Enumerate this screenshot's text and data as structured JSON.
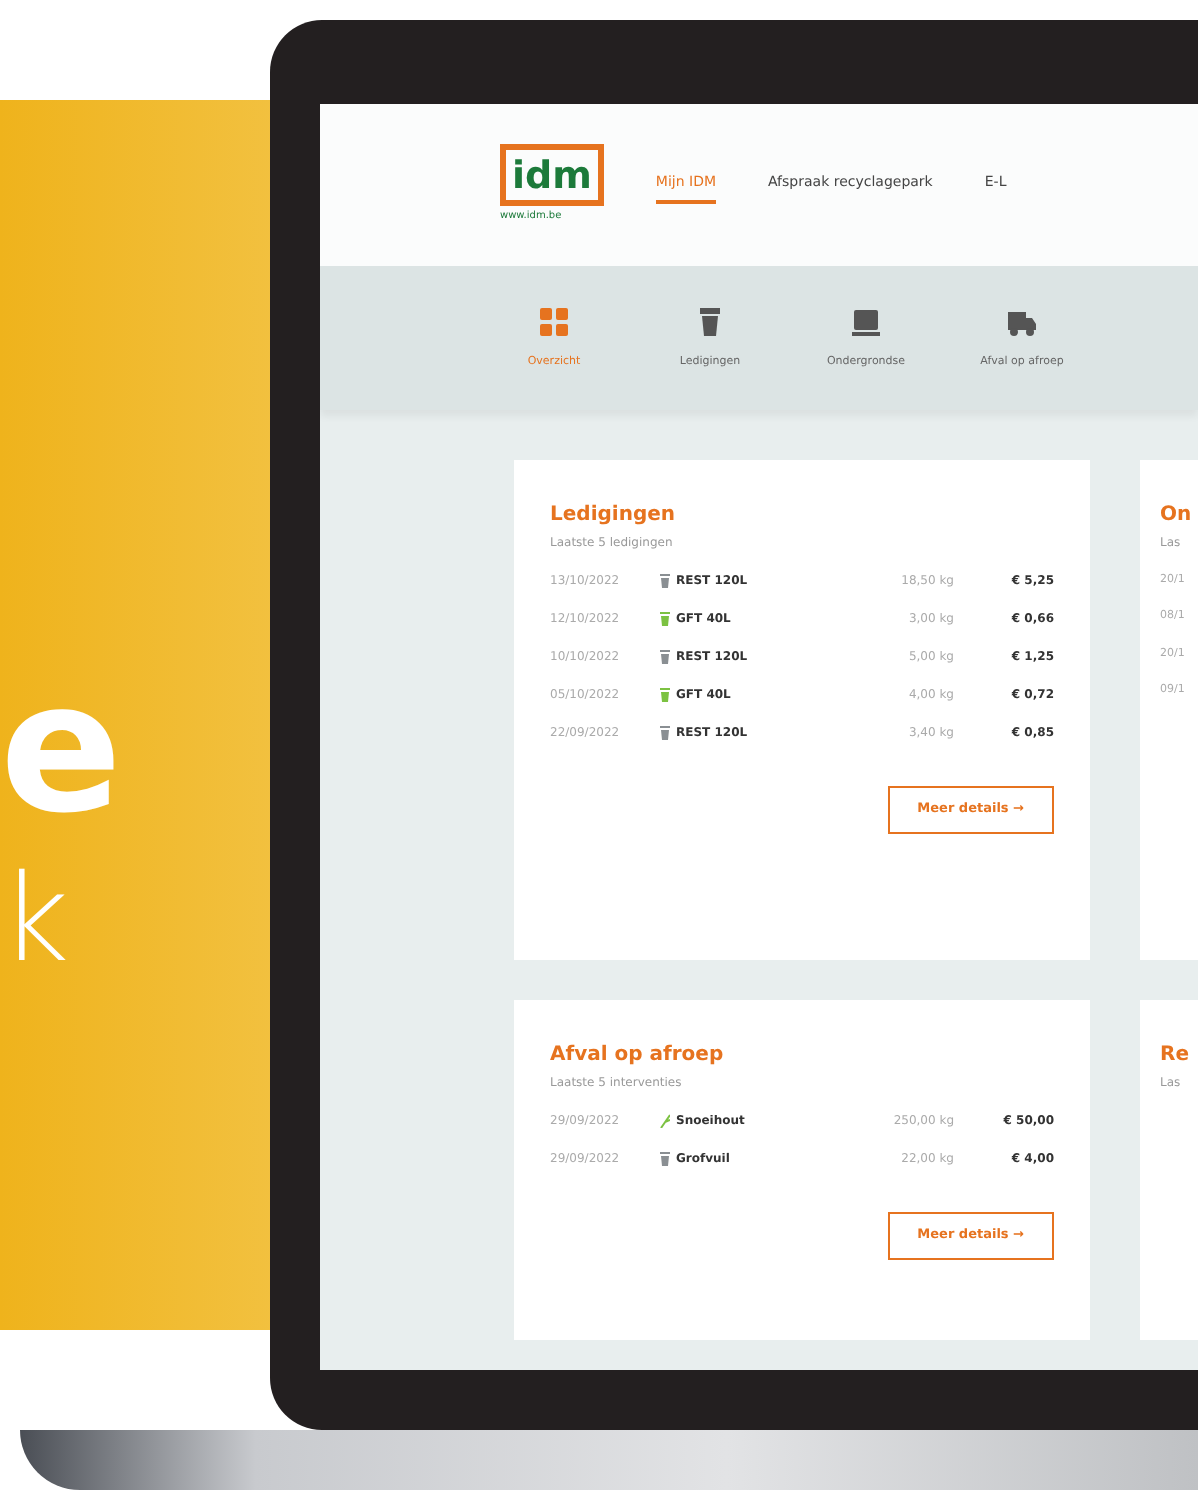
{
  "promo": {
    "letters": [
      "e",
      "k"
    ]
  },
  "header": {
    "logo": {
      "mark": "idm",
      "url": "www.idm.be"
    },
    "nav": [
      {
        "label": "Mijn IDM",
        "selected": true
      },
      {
        "label": "Afspraak recyclagepark",
        "selected": false
      },
      {
        "label": "E-L",
        "selected": false
      }
    ]
  },
  "tabs": [
    {
      "label": "Overzicht",
      "kind": "grid",
      "selected": true
    },
    {
      "label": "Ledigingen",
      "kind": "bin",
      "selected": false
    },
    {
      "label": "Ondergrondse",
      "kind": "container",
      "selected": false
    },
    {
      "label": "Afval op afroep",
      "kind": "truck",
      "selected": false
    }
  ],
  "cards": [
    {
      "title": "Ledigingen",
      "subtitle": "Laatste 5 ledigingen",
      "button": "Meer details",
      "button_icon": "→",
      "rows": [
        {
          "date": "13/10/2022",
          "item": "REST 120L",
          "kind": "bin",
          "color": "#8a8f93",
          "weight": "18,50 kg",
          "price": "€ 5,25"
        },
        {
          "date": "12/10/2022",
          "item": "GFT 40L",
          "kind": "bin",
          "color": "#7cc242",
          "weight": "3,00 kg",
          "price": "€ 0,66"
        },
        {
          "date": "10/10/2022",
          "item": "REST 120L",
          "kind": "bin",
          "color": "#8a8f93",
          "weight": "5,00 kg",
          "price": "€ 1,25"
        },
        {
          "date": "05/10/2022",
          "item": "GFT 40L",
          "kind": "bin",
          "color": "#7cc242",
          "weight": "4,00 kg",
          "price": "€ 0,72"
        },
        {
          "date": "22/09/2022",
          "item": "REST 120L",
          "kind": "bin",
          "color": "#8a8f93",
          "weight": "3,40 kg",
          "price": "€ 0,85"
        }
      ]
    },
    {
      "title": "Afval op afroep",
      "subtitle": "Laatste 5 interventies",
      "button": "Meer details",
      "button_icon": "→",
      "rows": [
        {
          "date": "29/09/2022",
          "item": "Snoeihout",
          "kind": "twig",
          "color": "#7cc242",
          "weight": "250,00 kg",
          "price": "€ 50,00"
        },
        {
          "date": "29/09/2022",
          "item": "Grofvuil",
          "kind": "bin",
          "color": "#8a8f93",
          "weight": "22,00 kg",
          "price": "€ 4,00"
        }
      ]
    }
  ],
  "side_cards": [
    {
      "title": "On",
      "subtitle": "Las",
      "rows": [
        "20/1",
        "08/1",
        "20/1",
        "09/1"
      ]
    },
    {
      "title": "Re",
      "subtitle": "Las"
    }
  ]
}
